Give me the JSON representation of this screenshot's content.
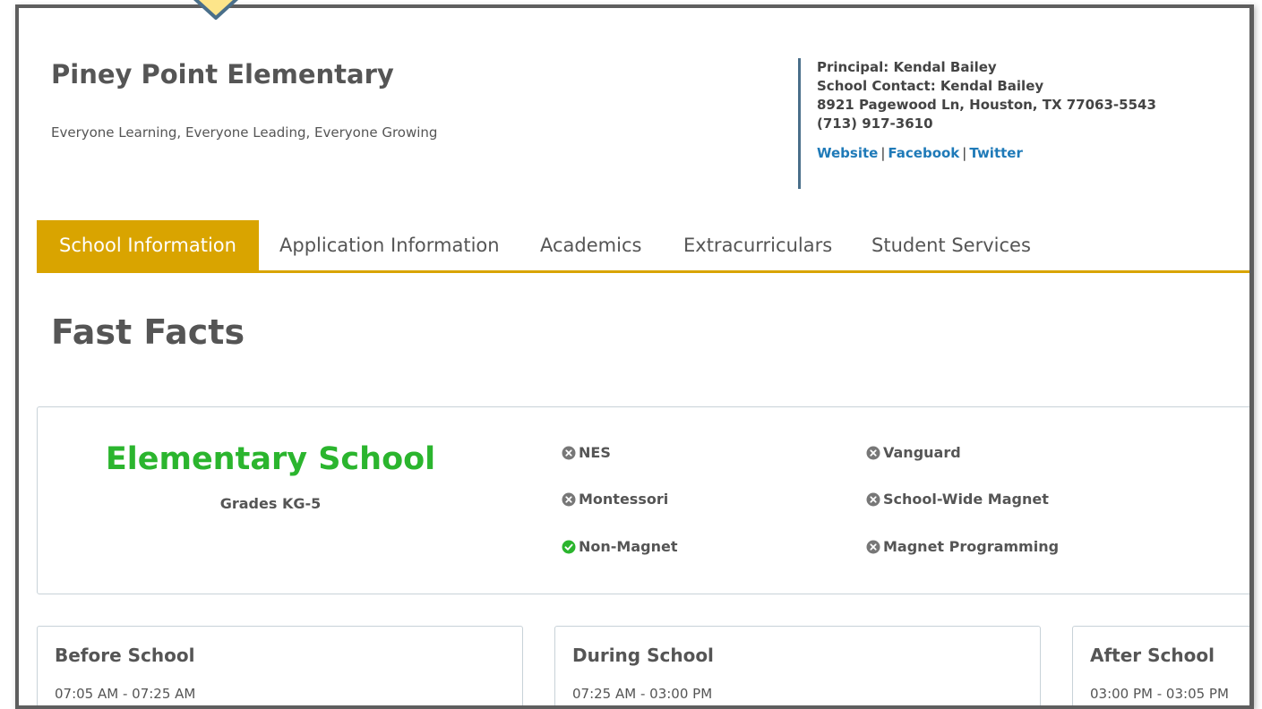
{
  "header": {
    "school_name": "Piney Point Elementary",
    "tagline": "Everyone Learning, Everyone Leading, Everyone Growing"
  },
  "contact": {
    "principal": "Principal: Kendal Bailey",
    "school_contact": "School Contact: Kendal Bailey",
    "address": "8921 Pagewood Ln, Houston, TX 77063-5543",
    "phone": "(713) 917-3610",
    "links": {
      "website": "Website",
      "facebook": "Facebook",
      "twitter": "Twitter",
      "separator": "|"
    }
  },
  "tabs": [
    {
      "label": "School Information",
      "active": true
    },
    {
      "label": "Application Information",
      "active": false
    },
    {
      "label": "Academics",
      "active": false
    },
    {
      "label": "Extracurriculars",
      "active": false
    },
    {
      "label": "Student Services",
      "active": false
    }
  ],
  "fast_facts": {
    "heading": "Fast Facts",
    "school_type": "Elementary School",
    "grades": "Grades KG-5",
    "features": [
      {
        "label": "NES",
        "status": "no",
        "icon": "x-circle-icon"
      },
      {
        "label": "Vanguard",
        "status": "no",
        "icon": "x-circle-icon"
      },
      {
        "label": "Montessori",
        "status": "no",
        "icon": "x-circle-icon"
      },
      {
        "label": "School-Wide Magnet",
        "status": "no",
        "icon": "x-circle-icon"
      },
      {
        "label": "Non-Magnet",
        "status": "yes",
        "icon": "check-circle-icon"
      },
      {
        "label": "Magnet Programming",
        "status": "no",
        "icon": "x-circle-icon"
      }
    ]
  },
  "schedule": [
    {
      "title": "Before School",
      "time": "07:05 AM - 07:25 AM"
    },
    {
      "title": "During School",
      "time": "07:25 AM - 03:00 PM"
    },
    {
      "title": "After School",
      "time": "03:00 PM - 03:05 PM"
    }
  ],
  "colors": {
    "accent_gold": "#d9a400",
    "school_type_green": "#2bb52e",
    "link_blue": "#1f7ab8",
    "check_green": "#2bb52e",
    "x_gray": "#777777",
    "callout_fill": "#fde58a",
    "callout_border": "#4a6f8a"
  }
}
